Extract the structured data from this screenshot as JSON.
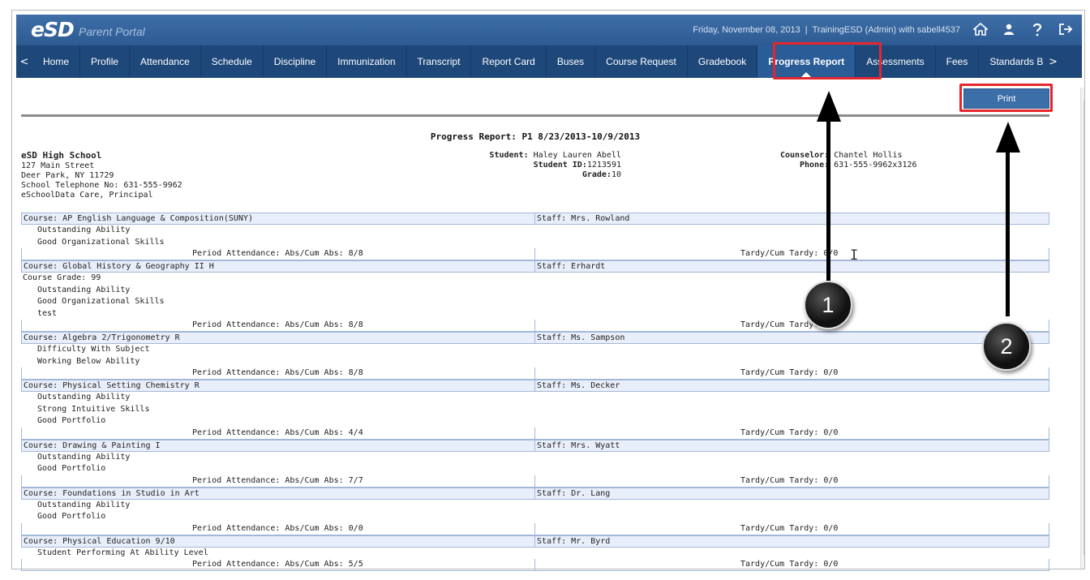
{
  "header": {
    "logo": "eSD",
    "portal_name": "Parent Portal",
    "date": "Friday, November 08, 2013",
    "user_info": "TrainingESD (Admin) with sabell4537",
    "icons": [
      "home-icon",
      "user-icon",
      "help-icon",
      "logout-icon"
    ]
  },
  "nav": {
    "prev_arrow": "<",
    "next_arrow": ">",
    "items": [
      {
        "label": "Home"
      },
      {
        "label": "Profile"
      },
      {
        "label": "Attendance"
      },
      {
        "label": "Schedule"
      },
      {
        "label": "Discipline"
      },
      {
        "label": "Immunization"
      },
      {
        "label": "Transcript"
      },
      {
        "label": "Report Card"
      },
      {
        "label": "Buses"
      },
      {
        "label": "Course Request"
      },
      {
        "label": "Gradebook"
      },
      {
        "label": "Progress Report"
      },
      {
        "label": "Assessments"
      },
      {
        "label": "Fees"
      },
      {
        "label": "Standards B"
      }
    ],
    "active": "Progress Report"
  },
  "toolbar": {
    "print_label": "Print"
  },
  "report": {
    "title": "Progress Report: P1 8/23/2013-10/9/2013",
    "school": {
      "name": "eSD High School",
      "address1": "127 Main Street",
      "address2": "Deer Park, NY 11729",
      "phone": "School Telephone No: 631-555-9962",
      "principal": "eSchoolData Care, Principal"
    },
    "student": {
      "name_label": "Student:",
      "name": "Haley Lauren Abell",
      "id_label": "Student ID:",
      "id": "1213591",
      "grade_label": "Grade:",
      "grade": "10"
    },
    "counselor": {
      "label": "Counselor:",
      "name": "Chantel Hollis",
      "phone_label": "Phone:",
      "phone": "631-555-9962x3126"
    },
    "courses": [
      {
        "course": "Course: AP English Language & Composition(SUNY)",
        "staff": "Staff: Mrs. Rowland",
        "lines": [
          {
            "text": "Outstanding Ability",
            "indent": true
          },
          {
            "text": "Good Organizational Skills",
            "indent": true
          }
        ],
        "period_att": "Period Attendance: Abs/Cum Abs: 8/8",
        "tardy": "Tardy/Cum Tardy: 0/0"
      },
      {
        "course": "Course: Global History & Geography II H",
        "staff": "Staff: Erhardt",
        "lines": [
          {
            "text": "Course Grade: 99",
            "indent": false
          },
          {
            "text": "Outstanding Ability",
            "indent": true
          },
          {
            "text": "Good Organizational Skills",
            "indent": true
          },
          {
            "text": "test",
            "indent": true
          }
        ],
        "period_att": "Period Attendance: Abs/Cum Abs: 8/8",
        "tardy": "Tardy/Cum Tardy: 0/0"
      },
      {
        "course": "Course: Algebra 2/Trigonometry R",
        "staff": "Staff: Ms. Sampson",
        "lines": [
          {
            "text": "Difficulty With Subject",
            "indent": true
          },
          {
            "text": "Working Below Ability",
            "indent": true
          }
        ],
        "period_att": "Period Attendance: Abs/Cum Abs: 8/8",
        "tardy": "Tardy/Cum Tardy: 0/0"
      },
      {
        "course": "Course: Physical Setting Chemistry R",
        "staff": "Staff: Ms. Decker",
        "lines": [
          {
            "text": "Outstanding Ability",
            "indent": true
          },
          {
            "text": "Strong Intuitive Skills",
            "indent": true
          },
          {
            "text": "Good Portfolio",
            "indent": true
          }
        ],
        "period_att": "Period Attendance: Abs/Cum Abs: 4/4",
        "tardy": "Tardy/Cum Tardy: 0/0"
      },
      {
        "course": "Course: Drawing & Painting I",
        "staff": "Staff: Mrs. Wyatt",
        "lines": [
          {
            "text": "Outstanding Ability",
            "indent": true
          },
          {
            "text": "Good Portfolio",
            "indent": true
          }
        ],
        "period_att": "Period Attendance: Abs/Cum Abs: 7/7",
        "tardy": "Tardy/Cum Tardy: 0/0"
      },
      {
        "course": "Course: Foundations in Studio in Art",
        "staff": "Staff: Dr. Lang",
        "lines": [
          {
            "text": "Outstanding Ability",
            "indent": true
          },
          {
            "text": "Good Portfolio",
            "indent": true
          }
        ],
        "period_att": "Period Attendance: Abs/Cum Abs: 0/0",
        "tardy": "Tardy/Cum Tardy: 0/0"
      },
      {
        "course": "Course: Physical Education 9/10",
        "staff": "Staff: Mr. Byrd",
        "lines": [
          {
            "text": "Student Performing At Ability Level",
            "indent": true
          }
        ],
        "period_att": "Period Attendance: Abs/Cum Abs: 5/5",
        "tardy": "Tardy/Cum Tardy: 0/0"
      }
    ]
  },
  "callouts": {
    "one": "1",
    "two": "2"
  },
  "colors": {
    "header": "#2d5a92",
    "nav": "#1e477a",
    "highlight": "#e5262c"
  }
}
